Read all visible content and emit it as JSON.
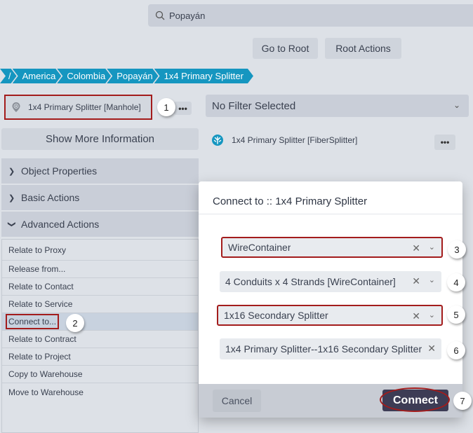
{
  "search": {
    "value": "Popayán",
    "icon": "search-icon"
  },
  "toolbar": {
    "go_to_root": "Go to Root",
    "root_actions": "Root Actions"
  },
  "breadcrumb": [
    "/",
    "America",
    "Colombia",
    "Popayán",
    "1x4 Primary Splitter"
  ],
  "selected_object": {
    "label": "1x4 Primary Splitter [Manhole]",
    "icon": "map-pin-icon",
    "menu": "•••"
  },
  "show_more": "Show More Information",
  "accordion": [
    {
      "label": "Object Properties",
      "expanded": false
    },
    {
      "label": "Basic Actions",
      "expanded": false
    },
    {
      "label": "Advanced Actions",
      "expanded": true
    }
  ],
  "advanced_actions": [
    "Relate to Proxy",
    "Release from...",
    "Relate to Contact",
    "Relate to Service",
    "Connect to...",
    "Relate to Contract",
    "Relate to Project",
    "Copy to Warehouse",
    "Move to Warehouse"
  ],
  "filter": {
    "value": "No Filter Selected"
  },
  "tree": {
    "label": "1x4 Primary Splitter [FiberSplitter]",
    "icon": "fiber-splitter-icon",
    "menu": "•••"
  },
  "modal": {
    "title": "Connect to :: 1x4 Primary Splitter",
    "fields": [
      {
        "value": "WireContainer"
      },
      {
        "value": "4 Conduits x 4 Strands [WireContainer]"
      },
      {
        "value": "1x16 Secondary Splitter"
      },
      {
        "value": "1x4 Primary Splitter--1x16 Secondary Splitter"
      }
    ],
    "cancel": "Cancel",
    "connect": "Connect"
  },
  "annotations": [
    "1",
    "2",
    "3",
    "4",
    "5",
    "6",
    "7"
  ],
  "colors": {
    "breadcrumb": "#1596c0",
    "highlight": "#a31c1c",
    "primary_button": "#3d3c55"
  }
}
